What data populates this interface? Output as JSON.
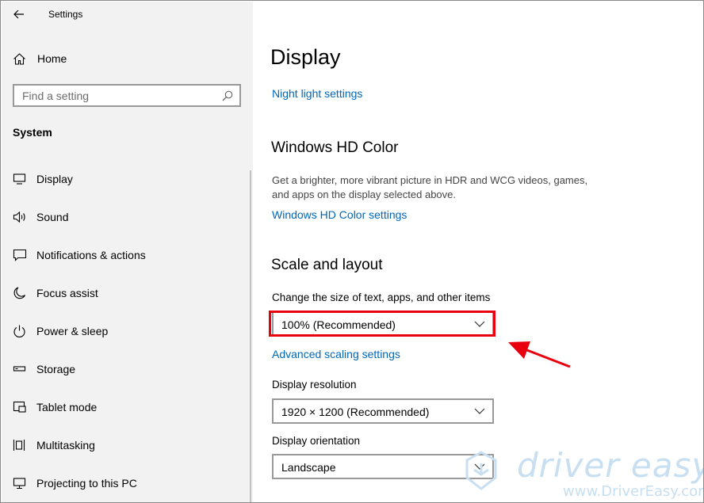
{
  "window": {
    "title": "Settings"
  },
  "sidebar": {
    "home_label": "Home",
    "search_placeholder": "Find a setting",
    "section_label": "System",
    "items": [
      {
        "label": "Display",
        "icon": "monitor-icon"
      },
      {
        "label": "Sound",
        "icon": "speaker-icon"
      },
      {
        "label": "Notifications & actions",
        "icon": "notification-icon"
      },
      {
        "label": "Focus assist",
        "icon": "moon-icon"
      },
      {
        "label": "Power & sleep",
        "icon": "power-icon"
      },
      {
        "label": "Storage",
        "icon": "storage-icon"
      },
      {
        "label": "Tablet mode",
        "icon": "tablet-icon"
      },
      {
        "label": "Multitasking",
        "icon": "multitasking-icon"
      },
      {
        "label": "Projecting to this PC",
        "icon": "projector-icon"
      }
    ]
  },
  "main": {
    "page_title": "Display",
    "night_light_link": "Night light settings",
    "hd_color": {
      "heading": "Windows HD Color",
      "desc_line1": "Get a brighter, more vibrant picture in HDR and WCG videos, games,",
      "desc_line2": "and apps on the display selected above.",
      "link": "Windows HD Color settings"
    },
    "scale": {
      "heading": "Scale and layout",
      "size_label": "Change the size of text, apps, and other items",
      "size_value": "100% (Recommended)",
      "advanced_link": "Advanced scaling settings",
      "resolution_label": "Display resolution",
      "resolution_value": "1920 × 1200 (Recommended)",
      "orientation_label": "Display orientation",
      "orientation_value": "Landscape"
    }
  },
  "watermark": {
    "brand": "driver easy",
    "url": "www.DriverEasy.com"
  },
  "colors": {
    "accent": "#0067b8",
    "highlight": "#e8000e",
    "sidebar_bg": "#f2f2f2"
  }
}
